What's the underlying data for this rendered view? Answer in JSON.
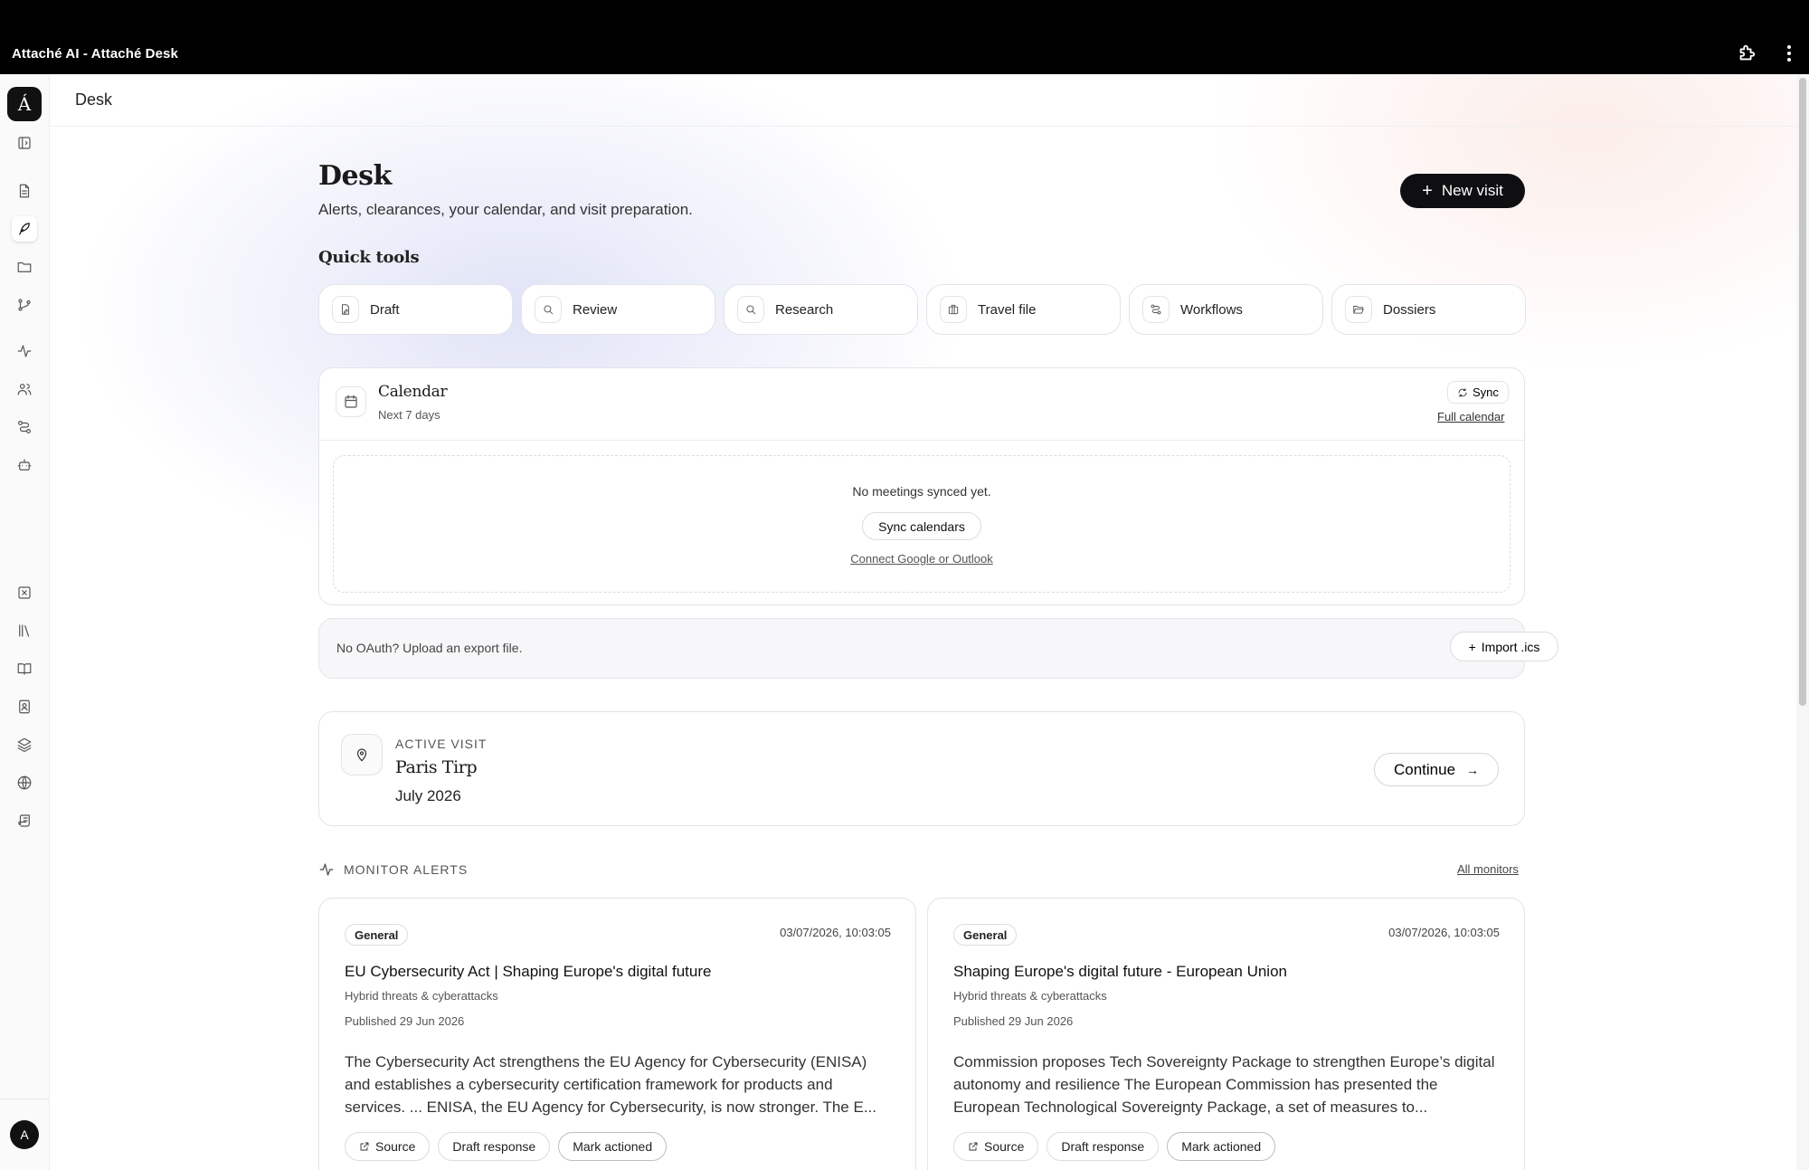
{
  "window": {
    "title": "Attaché AI - Attaché Desk"
  },
  "sidebar": {
    "logo": "Á",
    "avatar": "A",
    "icons": [
      "panel-toggle-icon",
      "document-icon",
      "quill-icon",
      "folder-icon",
      "branch-icon",
      "activity-icon",
      "users-icon",
      "route-icon",
      "bot-icon",
      "x-box-icon",
      "library-icon",
      "book-open-icon",
      "contact-book-icon",
      "layers-icon",
      "globe-icon",
      "scroll-icon"
    ]
  },
  "topbar": {
    "breadcrumb": "Desk"
  },
  "header": {
    "title": "Desk",
    "subtitle": "Alerts, clearances, your calendar, and visit preparation.",
    "new_visit_label": "New visit"
  },
  "quick_tools": {
    "heading": "Quick tools",
    "items": [
      {
        "label": "Draft",
        "icon": "draft-icon"
      },
      {
        "label": "Review",
        "icon": "search-icon"
      },
      {
        "label": "Research",
        "icon": "search-icon"
      },
      {
        "label": "Travel file",
        "icon": "briefcase-icon"
      },
      {
        "label": "Workflows",
        "icon": "route-icon"
      },
      {
        "label": "Dossiers",
        "icon": "folder-open-icon"
      }
    ]
  },
  "calendar": {
    "title": "Calendar",
    "subtitle": "Next 7 days",
    "sync_label": "Sync",
    "full_calendar_label": "Full calendar",
    "empty_text": "No meetings synced yet.",
    "sync_calendars_label": "Sync calendars",
    "connect_label": "Connect Google or Outlook"
  },
  "ics": {
    "note": "No OAuth? Upload an export file.",
    "import_label": "Import .ics"
  },
  "active_visit": {
    "label": "ACTIVE VISIT",
    "name": "Paris Tirp",
    "date": "July 2026",
    "continue_label": "Continue"
  },
  "monitor_alerts": {
    "heading": "MONITOR ALERTS",
    "all_label": "All monitors",
    "items": [
      {
        "tag": "General",
        "timestamp": "03/07/2026, 10:03:05",
        "title": "EU Cybersecurity Act | Shaping Europe's digital future",
        "category": "Hybrid threats & cyberattacks",
        "published": "Published 29 Jun 2026",
        "body": "The Cybersecurity Act strengthens the EU Agency for Cybersecurity (ENISA) and establishes a cybersecurity certification framework for products and services. ... ENISA, the EU Agency for Cybersecurity, is now stronger. The E...",
        "source_label": "Source",
        "draft_label": "Draft response",
        "mark_label": "Mark actioned"
      },
      {
        "tag": "General",
        "timestamp": "03/07/2026, 10:03:05",
        "title": "Shaping Europe's digital future - European Union",
        "category": "Hybrid threats & cyberattacks",
        "published": "Published 29 Jun 2026",
        "body": "Commission proposes Tech Sovereignty Package to strengthen Europe’s digital autonomy and resilience The European Commission has presented the European Technological Sovereignty Package, a set of measures to...",
        "source_label": "Source",
        "draft_label": "Draft response",
        "mark_label": "Mark actioned"
      }
    ]
  }
}
